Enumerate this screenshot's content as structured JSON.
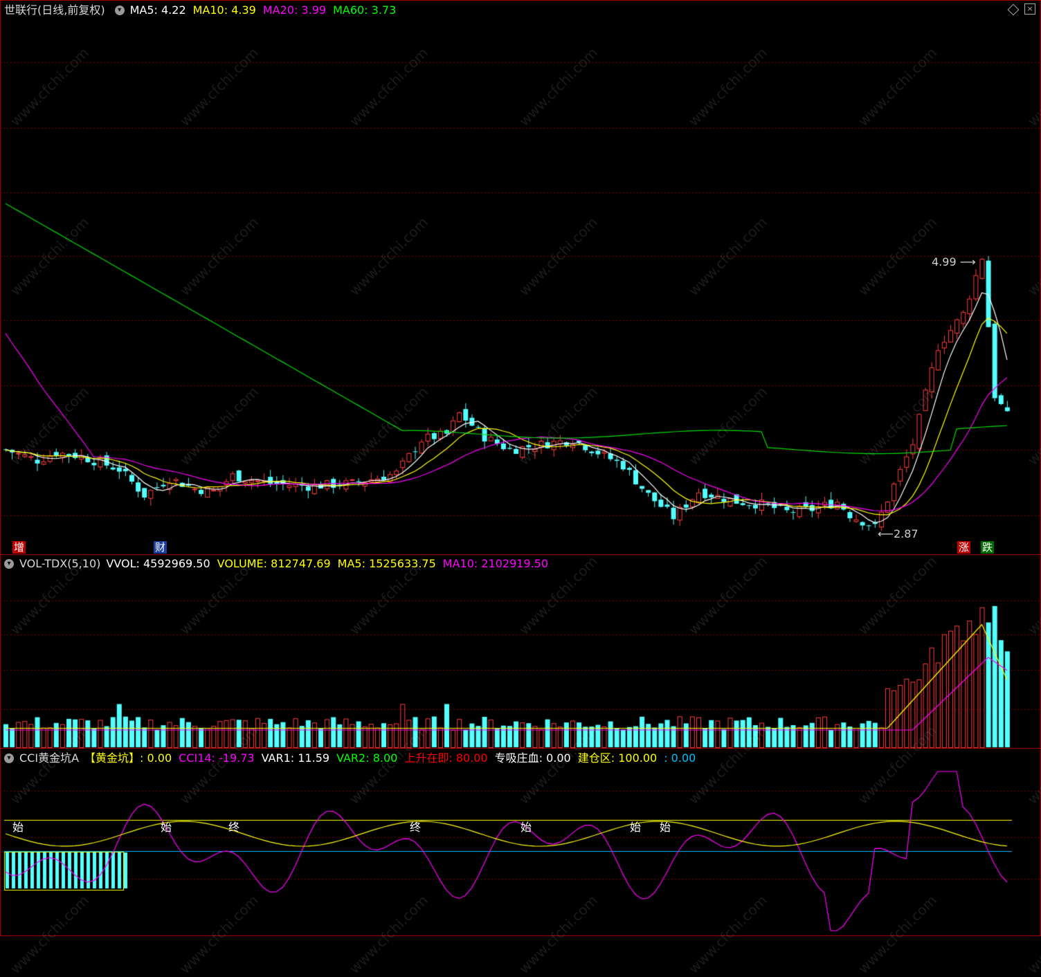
{
  "main_panel": {
    "stock_name": "世联行",
    "period_label": "(日线,前复权)",
    "ma": [
      {
        "label": "MA5:",
        "value": "4.22",
        "color": "#ffffff"
      },
      {
        "label": "MA10:",
        "value": "4.39",
        "color": "#ffff00"
      },
      {
        "label": "MA20:",
        "value": "3.99",
        "color": "#ff00ff"
      },
      {
        "label": "MA60:",
        "value": "3.73",
        "color": "#00ff00"
      }
    ],
    "high_label": "4.99",
    "low_label": "2.87",
    "tag_zeng": "增",
    "tag_cai": "财",
    "tag_zhang": "涨",
    "tag_die": "跌"
  },
  "vol_panel": {
    "name": "VOL-TDX(5,10)",
    "items": [
      {
        "label": "VVOL:",
        "value": "4592969.50",
        "color": "#ffffff"
      },
      {
        "label": "VOLUME:",
        "value": "812747.69",
        "color": "#ffff00"
      },
      {
        "label": "MA5:",
        "value": "1525633.75",
        "color": "#ffff00"
      },
      {
        "label": "MA10:",
        "value": "2102919.50",
        "color": "#ff00ff"
      }
    ]
  },
  "cci_panel": {
    "name": "CCI黄金坑A",
    "items": [
      {
        "label": "【黄金坑】:",
        "value": "0.00",
        "color": "#ffff00"
      },
      {
        "label": "CCI14:",
        "value": "-19.73",
        "color": "#ff00ff"
      },
      {
        "label": "VAR1:",
        "value": "11.59",
        "color": "#ffffff"
      },
      {
        "label": "VAR2:",
        "value": "8.00",
        "color": "#00ff00"
      },
      {
        "label": "上升在即:",
        "value": "80.00",
        "color": "#ff0000"
      },
      {
        "label": "专吸庄血:",
        "value": "0.00",
        "color": "#ffffff"
      },
      {
        "label": "建仓区:",
        "value": "100.00",
        "color": "#ffff00"
      },
      {
        "label": ":",
        "value": "0.00",
        "color": "#00bfff"
      }
    ],
    "marker_start": "始",
    "marker_end": "终"
  },
  "watermark": "www.cfchi.com",
  "colors": {
    "up": "#ff3c3c",
    "down": "#54ffff",
    "grid": "#7a0000"
  }
}
